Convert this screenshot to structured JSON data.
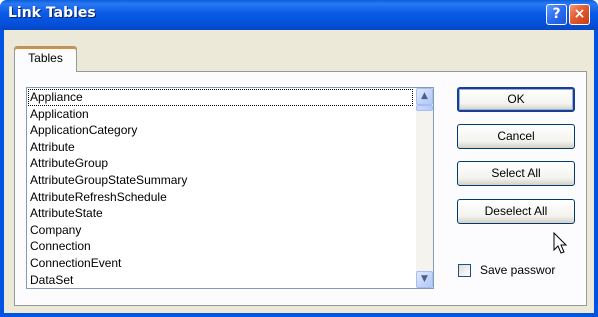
{
  "window": {
    "title": "Link Tables",
    "help_glyph": "?",
    "close_glyph": "×"
  },
  "tabs": [
    {
      "label": "Tables",
      "selected": true
    }
  ],
  "tables_list": {
    "items": [
      "Appliance",
      "Application",
      "ApplicationCategory",
      "Attribute",
      "AttributeGroup",
      "AttributeGroupStateSummary",
      "AttributeRefreshSchedule",
      "AttributeState",
      "Company",
      "Connection",
      "ConnectionEvent",
      "DataSet"
    ],
    "focused_index": 0,
    "scroll_up_glyph": "▲",
    "scroll_down_glyph": "▼"
  },
  "buttons": {
    "ok": "OK",
    "cancel": "Cancel",
    "select_all": "Select All",
    "deselect_all": "Deselect All"
  },
  "save_password": {
    "label": "Save passwor",
    "checked": false
  },
  "colors": {
    "titlebar": "#0054e3",
    "dialog_face": "#ece9d8",
    "tab_highlight": "#e68b2c"
  },
  "icons": {
    "help": "help-icon",
    "close": "close-icon",
    "cursor": "mouse-pointer-icon"
  }
}
